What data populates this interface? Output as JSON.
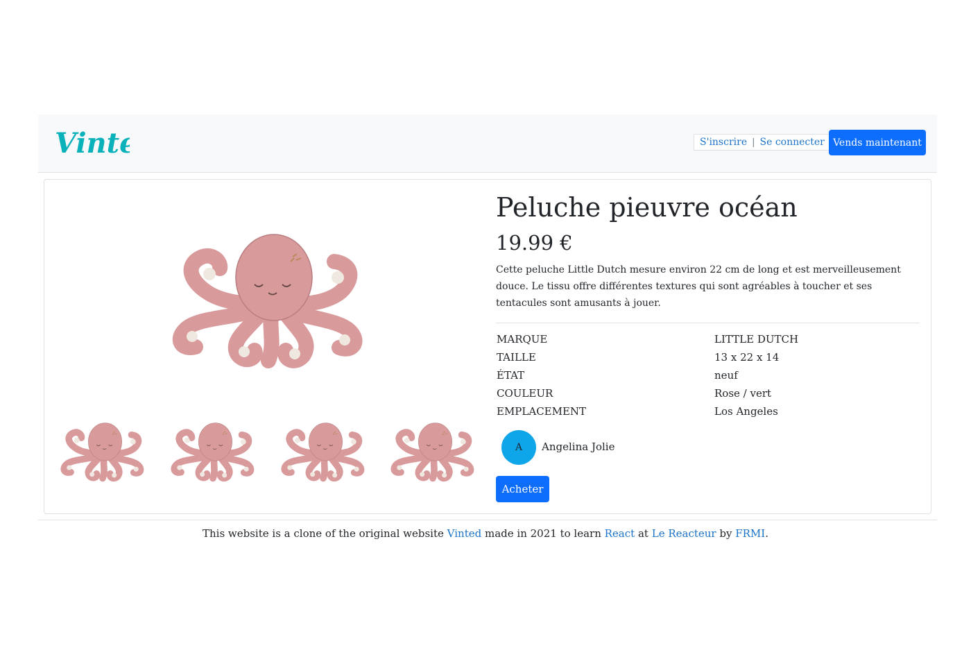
{
  "colors": {
    "brand": "#09b1ba",
    "primary_button": "#0d6efd",
    "link": "#1a73c8",
    "avatar": "#0ea5e9",
    "octopus": "#d99a9c"
  },
  "header": {
    "logo_text": "Vinted",
    "signup_label": "S'inscrire",
    "separator": "|",
    "login_label": "Se connecter",
    "sell_label": "Vends maintenant"
  },
  "product": {
    "title": "Peluche pieuvre océan",
    "price": "19.99 €",
    "description": "Cette peluche Little Dutch mesure environ 22 cm de long et est merveilleusement douce. Le tissu offre différentes textures qui sont agréables à toucher et ses tentacules sont amusants à jouer.",
    "main_image_icon": "octopus-plush-image",
    "thumbnail_count": 4,
    "specs": [
      {
        "key": "MARQUE",
        "value": "LITTLE DUTCH"
      },
      {
        "key": "TAILLE",
        "value": "13 x 22 x 14"
      },
      {
        "key": "ÉTAT",
        "value": "neuf"
      },
      {
        "key": "COULEUR",
        "value": "Rose / vert"
      },
      {
        "key": "EMPLACEMENT",
        "value": "Los Angeles"
      }
    ]
  },
  "seller": {
    "avatar_letter": "A",
    "name": "Angelina Jolie"
  },
  "buy_label": "Acheter",
  "footer": {
    "text_1": "This website is a clone of the original website",
    "link_vinted": "Vinted",
    "text_2": "made in 2021 to learn",
    "link_react": "React",
    "text_3": "at",
    "link_reacteur": "Le Reacteur",
    "text_4": "by",
    "link_author": "FRMI",
    "text_5": "."
  }
}
